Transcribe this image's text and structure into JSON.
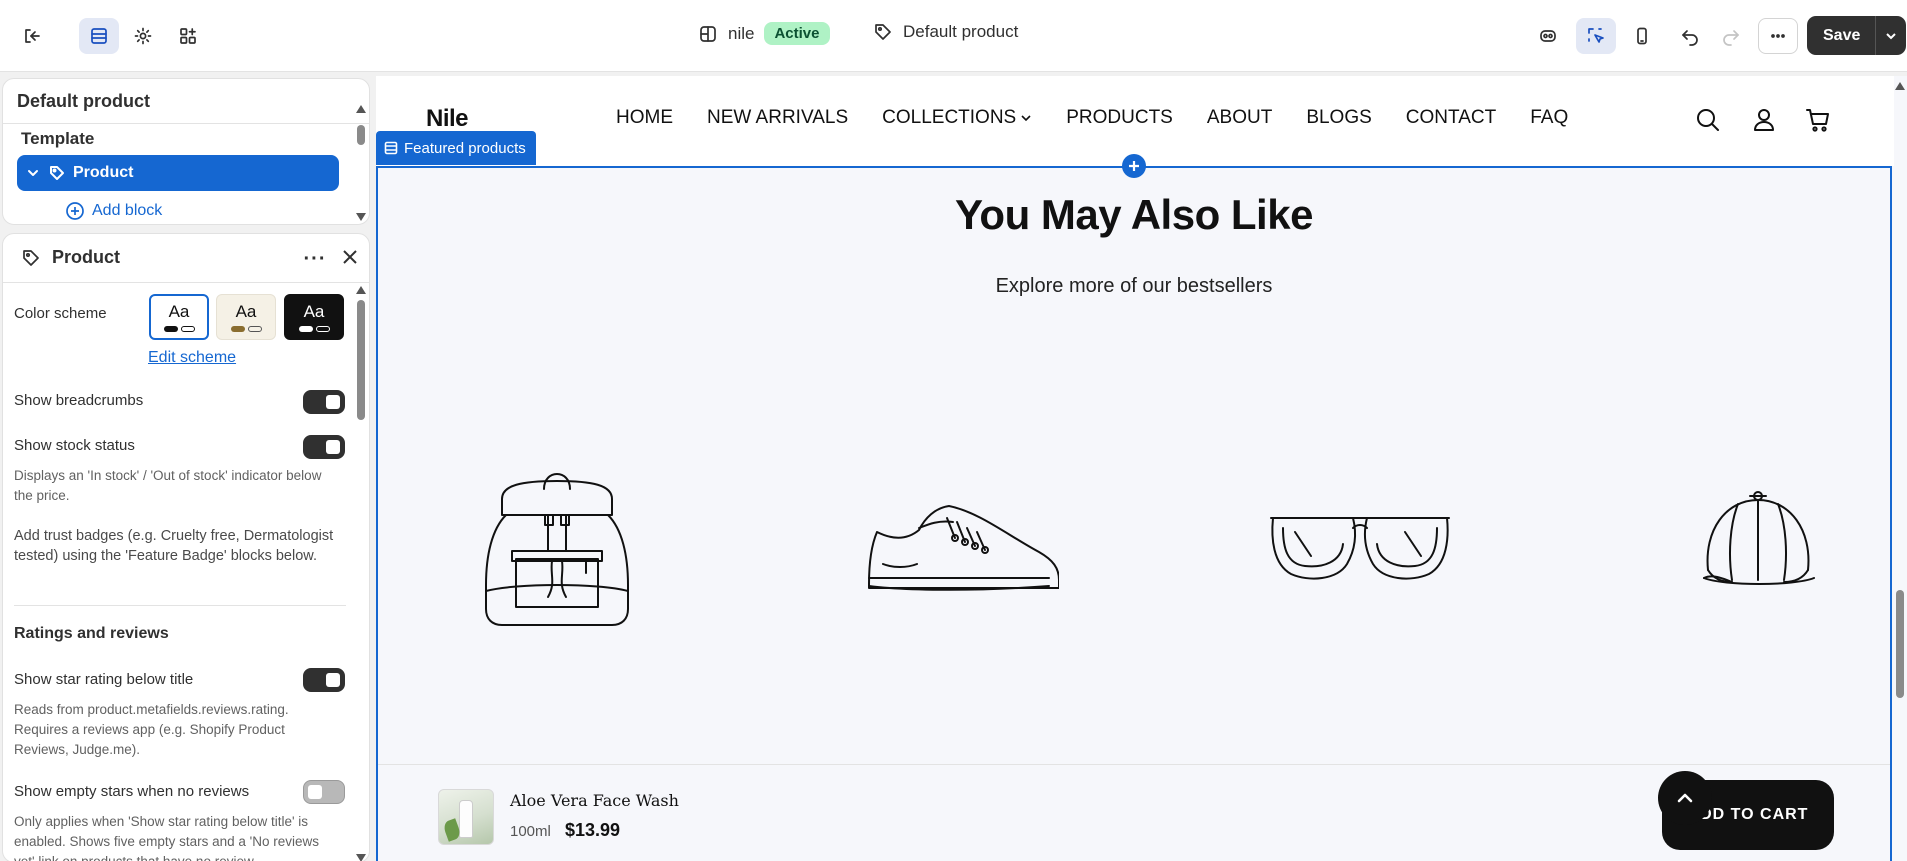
{
  "topbar": {
    "store_name": "nile",
    "store_status": "Active",
    "template_name": "Default product",
    "save_label": "Save"
  },
  "template_panel": {
    "title": "Default product",
    "template_label": "Template",
    "selected_item": "Product",
    "add_block_label": "Add block"
  },
  "settings_panel": {
    "title": "Product",
    "color_scheme_label": "Color scheme",
    "schemes": [
      {
        "sample": "Aa",
        "bg": "#ffffff",
        "fg": "#111111",
        "selected": true
      },
      {
        "sample": "Aa",
        "bg": "#f5f1e6",
        "fg": "#111111",
        "selected": false
      },
      {
        "sample": "Aa",
        "bg": "#111111",
        "fg": "#ffffff",
        "selected": false
      }
    ],
    "edit_scheme_label": "Edit scheme",
    "show_breadcrumbs_label": "Show breadcrumbs",
    "show_breadcrumbs_on": true,
    "show_stock_status_label": "Show stock status",
    "show_stock_status_on": true,
    "stock_status_desc": "Displays an 'In stock' / 'Out of stock' indicator below the price.",
    "trust_badges_note": "Add trust badges (e.g. Cruelty free, Dermatologist tested) using the 'Feature Badge' blocks below.",
    "ratings_heading": "Ratings and reviews",
    "show_star_rating_label": "Show star rating below title",
    "show_star_rating_on": true,
    "star_rating_desc": "Reads from product.metafields.reviews.rating. Requires a reviews app (e.g. Shopify Product Reviews, Judge.me).",
    "show_empty_stars_label": "Show empty stars when no reviews",
    "show_empty_stars_on": false,
    "empty_stars_desc": "Only applies when 'Show star rating below title' is enabled. Shows five empty stars and a 'No reviews yet' link on products that have no review"
  },
  "store": {
    "logo": "Nile",
    "nav": [
      "HOME",
      "NEW ARRIVALS",
      "COLLECTIONS",
      "PRODUCTS",
      "ABOUT",
      "BLOGS",
      "CONTACT",
      "FAQ"
    ],
    "section_tag": "Featured products",
    "heading": "You May Also Like",
    "subheading": "Explore more of our bestsellers",
    "products": [
      "backpack-icon",
      "sneaker-icon",
      "sunglasses-icon",
      "cap-icon"
    ],
    "sticky": {
      "name": "Aloe Vera Face Wash",
      "size": "100ml",
      "price": "$13.99",
      "cta": "ADD TO CART"
    }
  },
  "colors": {
    "accent": "#1567d1",
    "dark": "#303030",
    "active_badge_bg": "#aff2c5",
    "active_badge_fg": "#0c5132"
  }
}
